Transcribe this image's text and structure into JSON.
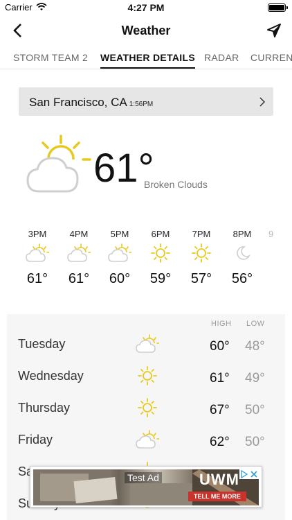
{
  "status_bar": {
    "carrier": "Carrier",
    "time": "4:27 PM"
  },
  "nav": {
    "title": "Weather"
  },
  "tabs": [
    {
      "label": "STORM TEAM 2"
    },
    {
      "label": "WEATHER DETAILS"
    },
    {
      "label": "RADAR"
    },
    {
      "label": "CURRENT"
    }
  ],
  "location": {
    "city": "San Francisco, CA",
    "time": "1:56PM"
  },
  "current": {
    "temp": "61°",
    "condition": "Broken Clouds",
    "icon": "partly-cloudy-icon"
  },
  "hourly": [
    {
      "time": "3PM",
      "icon": "partly-cloudy-icon",
      "temp": "61°"
    },
    {
      "time": "4PM",
      "icon": "partly-cloudy-icon",
      "temp": "61°"
    },
    {
      "time": "5PM",
      "icon": "partly-cloudy-icon",
      "temp": "60°"
    },
    {
      "time": "6PM",
      "icon": "sun-icon",
      "temp": "59°"
    },
    {
      "time": "7PM",
      "icon": "sun-icon",
      "temp": "57°"
    },
    {
      "time": "8PM",
      "icon": "moon-icon",
      "temp": "56°"
    }
  ],
  "daily_header": {
    "high": "HIGH",
    "low": "LOW"
  },
  "daily": [
    {
      "day": "Tuesday",
      "icon": "partly-cloudy-icon",
      "high": "60°",
      "low": "48°"
    },
    {
      "day": "Wednesday",
      "icon": "sun-icon",
      "high": "61°",
      "low": "49°"
    },
    {
      "day": "Thursday",
      "icon": "sun-icon",
      "high": "67°",
      "low": "50°"
    },
    {
      "day": "Friday",
      "icon": "partly-cloudy-icon",
      "high": "62°",
      "low": "50°"
    },
    {
      "day": "Saturday",
      "icon": "sun-icon",
      "high": "",
      "low": ""
    },
    {
      "day": "Sunday",
      "icon": "sun-icon",
      "high": "",
      "low": ""
    }
  ],
  "ad": {
    "label": "Test Ad",
    "brand": "UWM",
    "cta": "TELL ME MORE"
  },
  "colors": {
    "sun": "#e8c91e",
    "cloud": "#cfcfcf",
    "panel": "#f6f6f6",
    "location_card": "#e6e6e6"
  }
}
